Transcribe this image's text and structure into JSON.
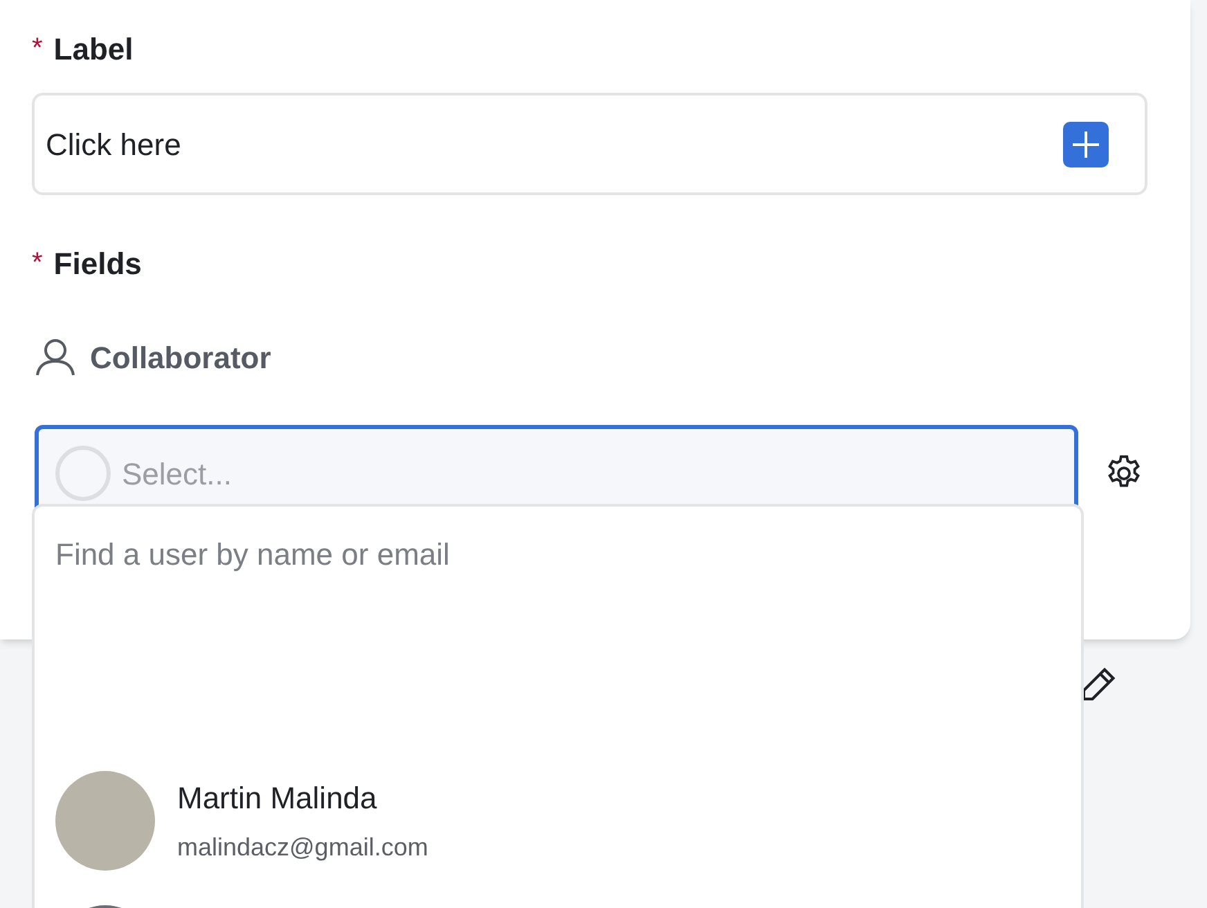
{
  "label_field": {
    "label": "Label",
    "required_mark": "*",
    "value": "Click here"
  },
  "fields_section": {
    "label": "Fields",
    "required_mark": "*"
  },
  "collaborator": {
    "label": "Collaborator",
    "select_placeholder": "Select..."
  },
  "dropdown": {
    "search_placeholder": "Find a user by name or email",
    "users": [
      {
        "name": "Martin Malinda",
        "email": "malindacz@gmail.com"
      }
    ]
  }
}
